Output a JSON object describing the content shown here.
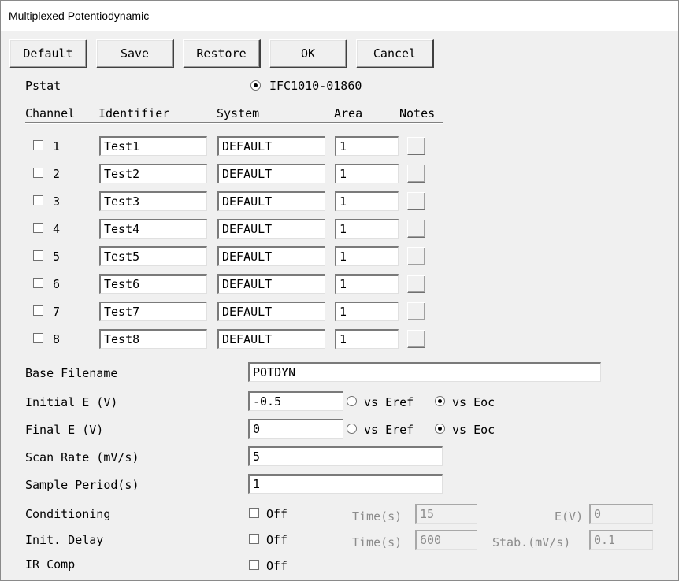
{
  "window": {
    "title": "Multiplexed Potentiodynamic"
  },
  "toolbar": {
    "default_label": "Default",
    "save_label": "Save",
    "restore_label": "Restore",
    "ok_label": "OK",
    "cancel_label": "Cancel"
  },
  "pstat": {
    "label": "Pstat",
    "device": "IFC1010-01860",
    "selected": true
  },
  "table": {
    "headers": {
      "channel": "Channel",
      "identifier": "Identifier",
      "system": "System",
      "area": "Area",
      "notes": "Notes"
    },
    "rows": [
      {
        "channel": "1",
        "checked": false,
        "identifier": "Test1",
        "system": "DEFAULT",
        "area": "1"
      },
      {
        "channel": "2",
        "checked": false,
        "identifier": "Test2",
        "system": "DEFAULT",
        "area": "1"
      },
      {
        "channel": "3",
        "checked": false,
        "identifier": "Test3",
        "system": "DEFAULT",
        "area": "1"
      },
      {
        "channel": "4",
        "checked": false,
        "identifier": "Test4",
        "system": "DEFAULT",
        "area": "1"
      },
      {
        "channel": "5",
        "checked": false,
        "identifier": "Test5",
        "system": "DEFAULT",
        "area": "1"
      },
      {
        "channel": "6",
        "checked": false,
        "identifier": "Test6",
        "system": "DEFAULT",
        "area": "1"
      },
      {
        "channel": "7",
        "checked": false,
        "identifier": "Test7",
        "system": "DEFAULT",
        "area": "1"
      },
      {
        "channel": "8",
        "checked": false,
        "identifier": "Test8",
        "system": "DEFAULT",
        "area": "1"
      }
    ]
  },
  "params": {
    "base_filename": {
      "label": "Base Filename",
      "value": "POTDYN"
    },
    "initial_e": {
      "label": "Initial E (V)",
      "value": "-0.5",
      "vs_eref": "vs Eref",
      "vs_eoc": "vs Eoc",
      "selected": "vs Eoc"
    },
    "final_e": {
      "label": "Final E (V)",
      "value": "0",
      "vs_eref": "vs Eref",
      "vs_eoc": "vs Eoc",
      "selected": "vs Eoc"
    },
    "scan_rate": {
      "label": "Scan Rate (mV/s)",
      "value": "5"
    },
    "sample_period": {
      "label": "Sample Period(s)",
      "value": "1"
    },
    "conditioning": {
      "label": "Conditioning",
      "toggle": "Off",
      "checked": false,
      "time_label": "Time(s)",
      "time_value": "15",
      "e_label": "E(V)",
      "e_value": "0"
    },
    "init_delay": {
      "label": "Init. Delay",
      "toggle": "Off",
      "checked": false,
      "time_label": "Time(s)",
      "time_value": "600",
      "stab_label": "Stab.(mV/s)",
      "stab_value": "0.1"
    },
    "ir_comp": {
      "label": "IR Comp",
      "toggle": "Off",
      "checked": false
    }
  }
}
